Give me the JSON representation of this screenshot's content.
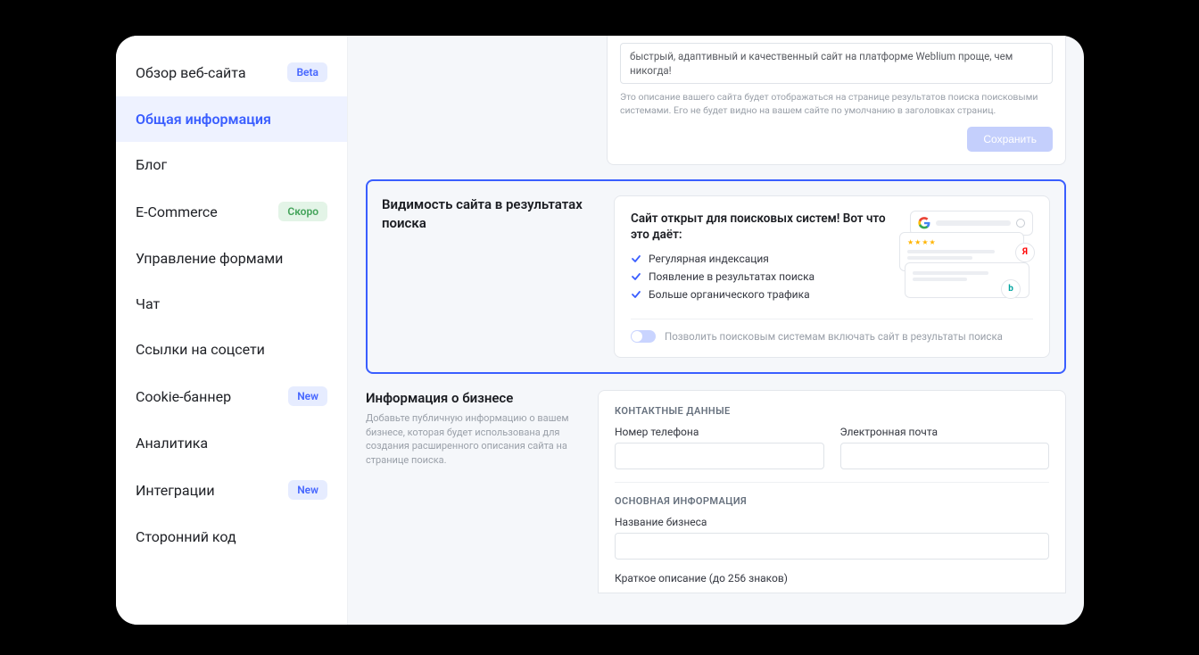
{
  "sidebar": {
    "items": [
      {
        "label": "Обзор веб-сайта",
        "badge": "Beta",
        "badgeType": "beta"
      },
      {
        "label": "Общая информация",
        "active": true
      },
      {
        "label": "Блог"
      },
      {
        "label": "E-Commerce",
        "badge": "Скоро",
        "badgeType": "soon"
      },
      {
        "label": "Управление формами"
      },
      {
        "label": "Чат"
      },
      {
        "label": "Ссылки на соцсети"
      },
      {
        "label": "Cookie-баннер",
        "badge": "New",
        "badgeType": "new"
      },
      {
        "label": "Аналитика"
      },
      {
        "label": "Интеграции",
        "badge": "New",
        "badgeType": "new"
      },
      {
        "label": "Сторонний код"
      }
    ]
  },
  "topCard": {
    "description": "быстрый, адаптивный и качественный сайт на платформе Weblium проще, чем никогда!",
    "help": "Это описание вашего сайта будет отображаться на странице результатов поиска поисковыми системами. Его не будет видно на вашем сайте по умолчанию в заголовках страниц.",
    "saveLabel": "Сохранить"
  },
  "visibility": {
    "title": "Видимость сайта в результатах поиска",
    "heading": "Сайт открыт для поисковых систем! Вот что это даёт:",
    "bullets": [
      "Регулярная индексация",
      "Появление в результатах поиска",
      "Больше органического трафика"
    ],
    "toggleLabel": "Позволить поисковым системам включать сайт в результаты поиска",
    "illus": {
      "yaLetter": "Я",
      "bingLetter": "b"
    }
  },
  "business": {
    "title": "Информация о бизнесе",
    "desc": "Добавьте публичную информацию о вашем бизнесе, которая будет использована для создания расширенного описания сайта на странице поиска.",
    "contactTitle": "КОНТАКТНЫЕ ДАННЫЕ",
    "phoneLabel": "Номер телефона",
    "emailLabel": "Электронная почта",
    "mainTitle": "ОСНОВНАЯ ИНФОРМАЦИЯ",
    "bizNameLabel": "Название бизнеса",
    "shortDescLabel": "Краткое описание (до 256 знаков)"
  }
}
